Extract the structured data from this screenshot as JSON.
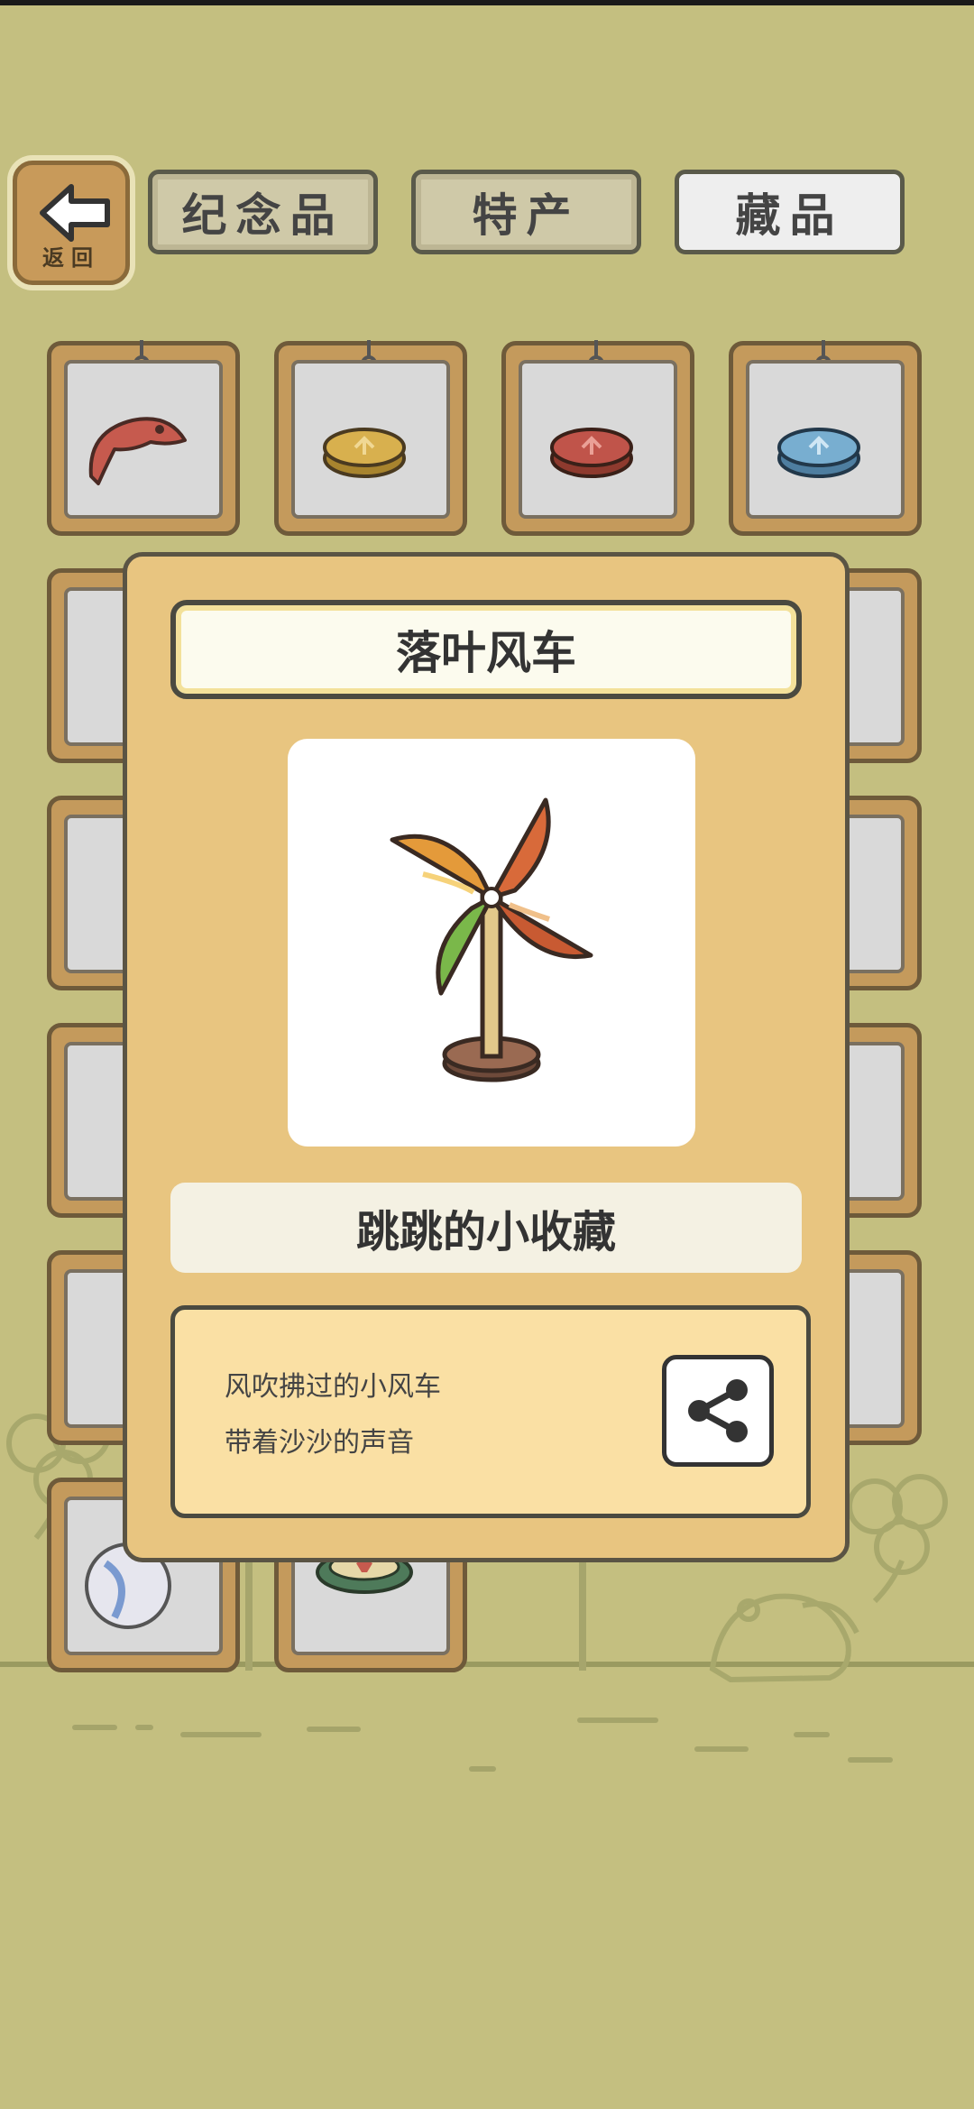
{
  "nav": {
    "back_label": "返回",
    "tabs": [
      {
        "label": "纪念品",
        "active": false
      },
      {
        "label": "特产",
        "active": false
      },
      {
        "label": "藏品",
        "active": true
      }
    ]
  },
  "grid": {
    "items": [
      {
        "icon": "red-leaf-item-icon"
      },
      {
        "icon": "yellow-coin-item-icon"
      },
      {
        "icon": "red-coin-item-icon"
      },
      {
        "icon": "blue-coin-item-icon"
      }
    ]
  },
  "detail": {
    "title": "落叶风车",
    "image_icon": "pinwheel-icon",
    "category": "跳跳的小收藏",
    "description_lines": [
      "风吹拂过的小风车",
      "带着沙沙的声音"
    ],
    "share_icon": "share-icon"
  },
  "colors": {
    "background": "#c4bf80",
    "modal": "#e8c580",
    "card_wood": "#c49a5c"
  }
}
